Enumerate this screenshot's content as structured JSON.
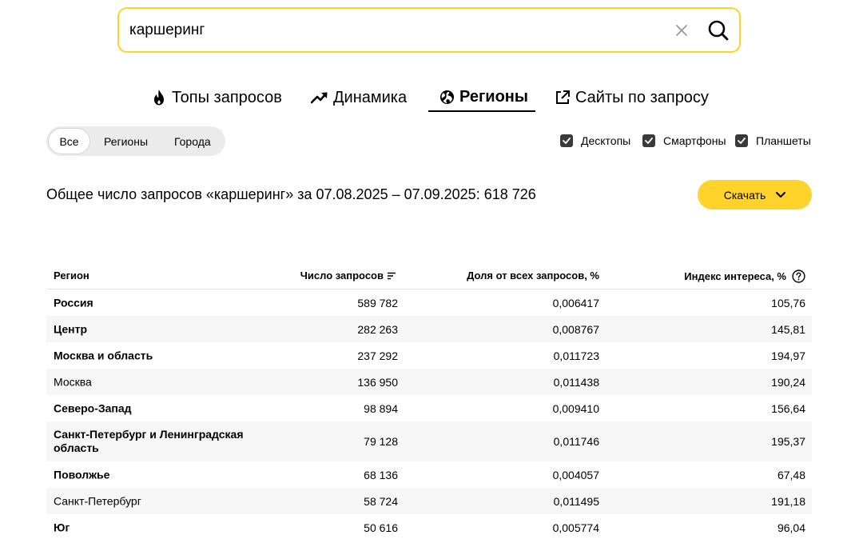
{
  "search": {
    "value": "каршеринг"
  },
  "tabs": [
    {
      "label": "Топы запросов",
      "icon": "fire-icon"
    },
    {
      "label": "Динамика",
      "icon": "trend-up-icon"
    },
    {
      "label": "Регионы",
      "icon": "globe-icon",
      "active": true
    },
    {
      "label": "Сайты по запросу",
      "icon": "external-link-icon"
    }
  ],
  "segments": [
    "Все",
    "Регионы",
    "Города"
  ],
  "devices": [
    {
      "label": "Десктопы",
      "checked": true
    },
    {
      "label": "Смартфоны",
      "checked": true
    },
    {
      "label": "Планшеты",
      "checked": true
    }
  ],
  "summary": {
    "text": "Общее число запросов «каршеринг» за 07.08.2025 – 07.09.2025: 618 726"
  },
  "download": {
    "label": "Скачать"
  },
  "table": {
    "headers": [
      "Регион",
      "Число запросов",
      "Доля от всех запросов, %",
      "Индекс интереса, %"
    ],
    "rows": [
      {
        "region": "Россия",
        "count": "589 782",
        "share": "0,006417",
        "index": "105,76",
        "bold": true
      },
      {
        "region": "Центр",
        "count": "282 263",
        "share": "0,008767",
        "index": "145,81",
        "bold": true
      },
      {
        "region": "Москва и область",
        "count": "237 292",
        "share": "0,011723",
        "index": "194,97",
        "bold": true
      },
      {
        "region": "Москва",
        "count": "136 950",
        "share": "0,011438",
        "index": "190,24",
        "bold": false
      },
      {
        "region": "Северо-Запад",
        "count": "98 894",
        "share": "0,009410",
        "index": "156,64",
        "bold": true
      },
      {
        "region": "Санкт-Петербург и Ленинградская область",
        "count": "79 128",
        "share": "0,011746",
        "index": "195,37",
        "bold": true
      },
      {
        "region": "Поволжье",
        "count": "68 136",
        "share": "0,004057",
        "index": "67,48",
        "bold": true
      },
      {
        "region": "Санкт-Петербург",
        "count": "58 724",
        "share": "0,011495",
        "index": "191,18",
        "bold": false
      },
      {
        "region": "Юг",
        "count": "50 616",
        "share": "0,005774",
        "index": "96,04",
        "bold": true
      }
    ]
  },
  "colors": {
    "accent": "#fed42b",
    "checkbox": "#3a3a3a",
    "row_alt": "#f6f6f6"
  }
}
